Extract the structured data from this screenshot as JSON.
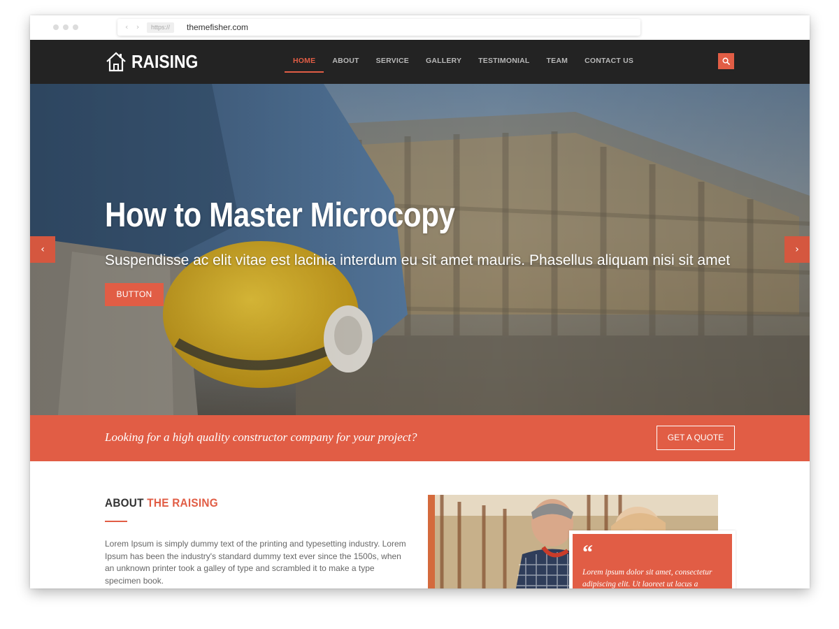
{
  "browser": {
    "address_protocol": "https://",
    "address_url": "themefisher.com",
    "nav_arrows": "‹ ›"
  },
  "header": {
    "logo_text": "RAISING",
    "logo_icon": "house-icon",
    "nav_items": [
      {
        "label": "HOME",
        "active": true
      },
      {
        "label": "ABOUT",
        "active": false
      },
      {
        "label": "SERVICE",
        "active": false
      },
      {
        "label": "GALLERY",
        "active": false
      },
      {
        "label": "TESTIMONIAL",
        "active": false
      },
      {
        "label": "TEAM",
        "active": false
      },
      {
        "label": "CONTACT US",
        "active": false
      }
    ],
    "search_icon": "search-icon"
  },
  "hero": {
    "title": "How to Master Microcopy",
    "subtitle": "Suspendisse ac elit vitae est lacinia interdum eu sit amet mauris. Phasellus aliquam nisi sit amet",
    "button_label": "BUTTON",
    "prev_icon": "‹",
    "next_icon": "›"
  },
  "cta": {
    "text": "Looking for a high quality constructor company for your project?",
    "button_label": "GET A QUOTE"
  },
  "about": {
    "heading_prefix": "ABOUT",
    "heading_accent": "THE RAISING",
    "body": "Lorem Ipsum is simply dummy text of the printing and typesetting industry. Lorem Ipsum has been the industry's standard dummy text ever since the 1500s, when an unknown printer took a galley of type and scrambled it to make a type specimen book.",
    "quote_mark": "“",
    "quote_text": "Lorem ipsum dolor sit amet, consectetur adipiscing elit. Ut laoreet ut lacus a"
  },
  "colors": {
    "accent": "#e15d45",
    "navbar_bg": "#232323",
    "nav_text": "#b9b9b9"
  }
}
